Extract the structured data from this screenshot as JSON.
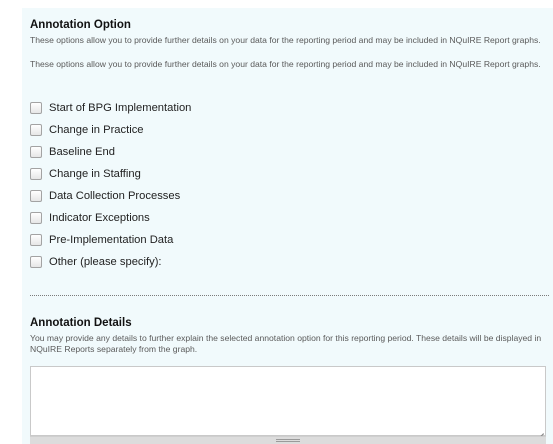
{
  "annotation_option": {
    "title": "Annotation Option",
    "help_1": "These options allow you to provide further details on your data for the reporting period and may be included in NQuIRE Report graphs.",
    "help_2": "These options allow you to provide further details on your data for the reporting period and may be included in NQuIRE Report graphs.",
    "options": [
      {
        "label": "Start of BPG Implementation",
        "checked": false
      },
      {
        "label": "Change in Practice",
        "checked": false
      },
      {
        "label": "Baseline End",
        "checked": false
      },
      {
        "label": "Change in Staffing",
        "checked": false
      },
      {
        "label": "Data Collection Processes",
        "checked": false
      },
      {
        "label": "Indicator Exceptions",
        "checked": false
      },
      {
        "label": "Pre-Implementation Data",
        "checked": false
      },
      {
        "label": "Other (please specify):",
        "checked": false
      }
    ]
  },
  "annotation_details": {
    "title": "Annotation Details",
    "help": "You may provide any details to further explain the selected annotation option for this reporting period. These details will be displayed in NQuIRE Reports separately from the graph.",
    "value": "",
    "placeholder": ""
  },
  "colors": {
    "panel_background": "#f1fafc",
    "heading_text": "#111111",
    "help_text": "#5a5a5a"
  }
}
